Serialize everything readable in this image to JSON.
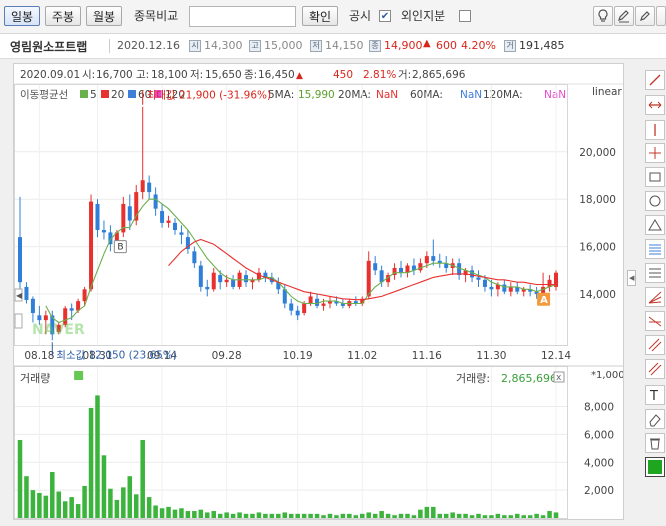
{
  "toolbar": {
    "periods": [
      {
        "label": "일봉",
        "active": true
      },
      {
        "label": "주봉",
        "active": false
      },
      {
        "label": "월봉",
        "active": false
      }
    ],
    "compare_label": "종목비교",
    "compare_value": "",
    "confirm_label": "확인",
    "disclosure_label": "공시",
    "disclosure_checked": true,
    "foreign_label": "외인지분",
    "foreign_checked": false,
    "icons": [
      "lightbulb-icon",
      "edit-icon",
      "pencil-icon",
      "refresh-icon"
    ]
  },
  "info": {
    "name": "영림원소프트랩",
    "date": "2020.12.16",
    "start_badge": "시",
    "start": "14,300",
    "high_badge": "고",
    "high": "15,000",
    "low_badge": "저",
    "low": "14,150",
    "close_badge": "종",
    "close": "14,900",
    "change": "600",
    "change_pct": "4.20%",
    "volume_badge": "거",
    "volume": "191,485",
    "up_arrow": "▲"
  },
  "chart": {
    "ohlc_line": {
      "date": "2020.09.01",
      "open_label": "시:",
      "open": "16,700",
      "high_label": "고:",
      "high": "18,100",
      "low_label": "저:",
      "low": "15,650",
      "close_label": "종:",
      "close": "16,450",
      "arrow": "▲",
      "change": "450",
      "pct": "2.81%",
      "vol_label": "거:",
      "vol": "2,865,696"
    },
    "ma_legend": {
      "title": "이동평균선",
      "items": [
        {
          "label": "5",
          "color": "#6ab04c"
        },
        {
          "label": "20",
          "color": "#e8312f"
        },
        {
          "label": "60",
          "color": "#3f7fd8"
        },
        {
          "label": "120",
          "color": "#e84ac8"
        }
      ]
    },
    "ma_values": [
      {
        "label": "5MA:",
        "value": "15,990",
        "color": "#5aa02c"
      },
      {
        "label": "20MA:",
        "value": "NaN",
        "color": "#e8312f"
      },
      {
        "label": "60MA:",
        "value": "NaN",
        "color": "#3f7fd8"
      },
      {
        "label": "120MA:",
        "value": "NaN",
        "color": "#e84ac8"
      }
    ],
    "scale_label": "linear",
    "max_label": "최대값 21,900 (-31.96%)",
    "min_label": "최소값 12,050 (23.65%)",
    "watermark": "NAVER",
    "badge_b": "B",
    "badge_a": "A",
    "volume_title": "거래량",
    "volume_value_label": "거래량:",
    "volume_value": "2,865,696",
    "volume_unit": "*1,000",
    "close_x": "x"
  },
  "chart_data": {
    "type": "candlestick",
    "price_axis": {
      "ticks": [
        "14,000",
        "16,000",
        "18,000",
        "20,000"
      ],
      "values": [
        14000,
        16000,
        18000,
        20000
      ],
      "ylim": [
        11850,
        22100
      ]
    },
    "volume_axis": {
      "ticks": [
        "2,000",
        "4,000",
        "6,000",
        "8,000"
      ],
      "values": [
        2000,
        4000,
        6000,
        8000
      ],
      "ylim": [
        0,
        8900
      ]
    },
    "x_ticks": [
      {
        "label": "08.18",
        "index": 3
      },
      {
        "label": "08.31",
        "index": 12
      },
      {
        "label": "09.14",
        "index": 22
      },
      {
        "label": "09.28",
        "index": 32
      },
      {
        "label": "10.19",
        "index": 43
      },
      {
        "label": "11.02",
        "index": 53
      },
      {
        "label": "11.16",
        "index": 63
      },
      {
        "label": "11.30",
        "index": 73
      },
      {
        "label": "12.14",
        "index": 83
      }
    ],
    "candles": [
      [
        16400,
        18100,
        14100,
        14500
      ],
      [
        14300,
        14500,
        13600,
        13750
      ],
      [
        13800,
        13900,
        12800,
        13200
      ],
      [
        13100,
        13500,
        12700,
        12900
      ],
      [
        12900,
        13300,
        12300,
        13100
      ],
      [
        13100,
        13300,
        12050,
        12300
      ],
      [
        12400,
        12800,
        12300,
        12700
      ],
      [
        12700,
        13500,
        12600,
        13400
      ],
      [
        13400,
        13600,
        12900,
        13300
      ],
      [
        13300,
        13800,
        13200,
        13700
      ],
      [
        13700,
        14300,
        13500,
        14200
      ],
      [
        14200,
        18200,
        14100,
        17900
      ],
      [
        17800,
        18000,
        16400,
        16700
      ],
      [
        16700,
        17100,
        16300,
        16600
      ],
      [
        16600,
        16900,
        15800,
        16100
      ],
      [
        16200,
        16700,
        15900,
        16600
      ],
      [
        16600,
        18100,
        16400,
        17800
      ],
      [
        17700,
        18200,
        16700,
        17100
      ],
      [
        17100,
        18600,
        16900,
        18300
      ],
      [
        18300,
        21900,
        18000,
        18800
      ],
      [
        18700,
        19000,
        18000,
        18300
      ],
      [
        18200,
        18500,
        17300,
        17600
      ],
      [
        17500,
        17800,
        16800,
        17000
      ],
      [
        17000,
        17300,
        16800,
        17100
      ],
      [
        17000,
        17200,
        16500,
        16700
      ],
      [
        16600,
        16900,
        16100,
        16500
      ],
      [
        16400,
        16700,
        15700,
        15900
      ],
      [
        15800,
        16000,
        15100,
        15300
      ],
      [
        15200,
        15400,
        14100,
        14300
      ],
      [
        14300,
        14600,
        13900,
        14200
      ],
      [
        14200,
        15100,
        14100,
        14900
      ],
      [
        14800,
        15000,
        14200,
        14500
      ],
      [
        14500,
        14800,
        14300,
        14600
      ],
      [
        14600,
        14800,
        14200,
        14300
      ],
      [
        14300,
        15000,
        14200,
        14900
      ],
      [
        14800,
        15000,
        14300,
        14500
      ],
      [
        14500,
        14700,
        14200,
        14600
      ],
      [
        14600,
        15100,
        14500,
        14900
      ],
      [
        14900,
        15000,
        14500,
        14700
      ],
      [
        14700,
        14900,
        14400,
        14500
      ],
      [
        14500,
        14700,
        14000,
        14200
      ],
      [
        14200,
        14400,
        13400,
        13600
      ],
      [
        13600,
        13800,
        13100,
        13300
      ],
      [
        13300,
        13500,
        12900,
        13100
      ],
      [
        13200,
        13700,
        13100,
        13600
      ],
      [
        13600,
        14100,
        13500,
        13900
      ],
      [
        13800,
        14000,
        13400,
        13500
      ],
      [
        13500,
        13800,
        13300,
        13600
      ],
      [
        13600,
        13900,
        13400,
        13700
      ],
      [
        13700,
        13900,
        13500,
        13600
      ],
      [
        13600,
        13800,
        13400,
        13500
      ],
      [
        13500,
        13800,
        13400,
        13700
      ],
      [
        13700,
        13900,
        13500,
        13600
      ],
      [
        13600,
        13900,
        13500,
        13800
      ],
      [
        13900,
        15800,
        13800,
        15400
      ],
      [
        15300,
        15600,
        14800,
        15000
      ],
      [
        15000,
        15200,
        14300,
        14500
      ],
      [
        14500,
        14900,
        14300,
        14800
      ],
      [
        14800,
        15300,
        14600,
        15100
      ],
      [
        15100,
        15400,
        14700,
        14900
      ],
      [
        14900,
        15300,
        14700,
        15200
      ],
      [
        15200,
        15500,
        14800,
        15000
      ],
      [
        15000,
        15500,
        14900,
        15300
      ],
      [
        15300,
        15800,
        15100,
        15600
      ],
      [
        15600,
        16300,
        15200,
        15400
      ],
      [
        15400,
        15700,
        15100,
        15300
      ],
      [
        15300,
        15600,
        14900,
        15100
      ],
      [
        15100,
        15500,
        14800,
        15300
      ],
      [
        15300,
        15500,
        14600,
        14800
      ],
      [
        14800,
        15100,
        14500,
        15000
      ],
      [
        15000,
        15200,
        14500,
        14700
      ],
      [
        14700,
        15000,
        14300,
        14600
      ],
      [
        14600,
        14800,
        14100,
        14300
      ],
      [
        14300,
        14600,
        13900,
        14200
      ],
      [
        14200,
        14500,
        13900,
        14400
      ],
      [
        14400,
        14600,
        14000,
        14100
      ],
      [
        14100,
        14500,
        13900,
        14300
      ],
      [
        14300,
        14500,
        14000,
        14100
      ],
      [
        14100,
        14300,
        13900,
        14200
      ],
      [
        14200,
        14400,
        13900,
        14100
      ],
      [
        14100,
        14300,
        13800,
        14000
      ],
      [
        14000,
        14900,
        13900,
        14300
      ],
      [
        14300,
        14800,
        14100,
        14600
      ],
      [
        14300,
        15000,
        14150,
        14900
      ]
    ],
    "ma5": [
      null,
      null,
      null,
      null,
      13500,
      13000,
      12800,
      12900,
      13000,
      13300,
      13500,
      14300,
      15000,
      15700,
      16300,
      16600,
      16800,
      16800,
      17300,
      17700,
      18000,
      18000,
      17800,
      17600,
      17300,
      17000,
      16700,
      16300,
      15900,
      15500,
      15200,
      14900,
      14700,
      14600,
      14600,
      14600,
      14600,
      14600,
      14700,
      14700,
      14500,
      14200,
      13900,
      13700,
      13600,
      13600,
      13600,
      13700,
      13700,
      13700,
      13600,
      13600,
      13600,
      13600,
      14000,
      14300,
      14500,
      14700,
      14900,
      14900,
      14900,
      15000,
      15100,
      15200,
      15300,
      15300,
      15300,
      15200,
      15100,
      15000,
      14900,
      14800,
      14700,
      14500,
      14400,
      14300,
      14300,
      14300,
      14200,
      14200,
      14100,
      14200,
      14300,
      14400
    ],
    "ma20": [
      null,
      null,
      null,
      null,
      null,
      null,
      null,
      null,
      null,
      null,
      null,
      null,
      null,
      null,
      null,
      null,
      null,
      null,
      null,
      null,
      null,
      null,
      null,
      15200,
      15500,
      15800,
      16000,
      16200,
      16300,
      16200,
      16100,
      15900,
      15700,
      15500,
      15300,
      15100,
      14950,
      14800,
      14700,
      14600,
      14500,
      14400,
      14300,
      14200,
      14100,
      14050,
      14000,
      13950,
      13900,
      13850,
      13800,
      13780,
      13760,
      13760,
      13800,
      13850,
      13900,
      14000,
      14100,
      14200,
      14300,
      14400,
      14500,
      14600,
      14700,
      14750,
      14800,
      14850,
      14850,
      14850,
      14800,
      14750,
      14700,
      14650,
      14600,
      14600,
      14550,
      14500,
      14500,
      14450,
      14400,
      14400,
      14400,
      14400
    ],
    "volume": [
      5600,
      3000,
      2000,
      1800,
      1600,
      3300,
      1900,
      1200,
      1500,
      1000,
      2300,
      7900,
      8800,
      4500,
      2100,
      1300,
      2200,
      3000,
      1700,
      5600,
      1500,
      900,
      700,
      800,
      600,
      700,
      500,
      500,
      600,
      400,
      500,
      300,
      400,
      300,
      400,
      300,
      300,
      400,
      300,
      300,
      300,
      400,
      300,
      300,
      300,
      300,
      300,
      200,
      300,
      200,
      300,
      300,
      200,
      300,
      400,
      300,
      500,
      300,
      200,
      300,
      300,
      200,
      600,
      800,
      800,
      300,
      300,
      400,
      300,
      300,
      200,
      300,
      200,
      200,
      300,
      200,
      200,
      300,
      200,
      200,
      300,
      200,
      500,
      400
    ],
    "volume_marker_index": 9
  }
}
